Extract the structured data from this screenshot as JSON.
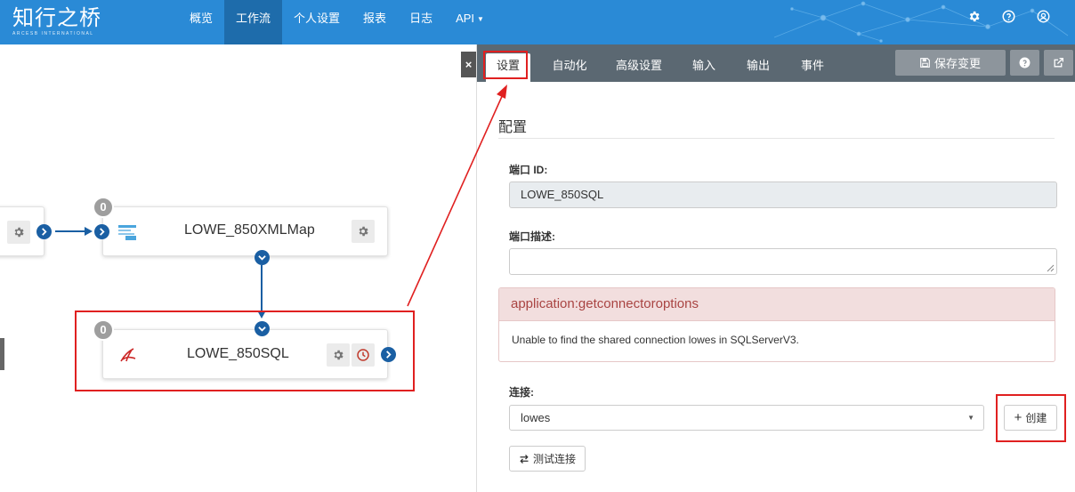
{
  "app": {
    "logo_text": "知行之桥",
    "logo_subtext": "ARCESB INTERNATIONAL"
  },
  "nav": {
    "items": [
      {
        "label": "概览"
      },
      {
        "label": "工作流"
      },
      {
        "label": "个人设置"
      },
      {
        "label": "报表"
      },
      {
        "label": "日志"
      },
      {
        "label": "API"
      }
    ],
    "active": "工作流",
    "top_icons": [
      "gear-icon",
      "help-icon",
      "user-icon"
    ]
  },
  "canvas": {
    "nodes": [
      {
        "title": "",
        "icon": "gear-icon"
      },
      {
        "title": "LOWE_850XMLMap",
        "badge": "0",
        "icon": "xml-map-icon"
      },
      {
        "title": "LOWE_850SQL",
        "badge": "0",
        "icon": "sqlserver-icon"
      }
    ],
    "close_label": "×"
  },
  "panel": {
    "tabs": [
      {
        "label": "设置"
      },
      {
        "label": "自动化"
      },
      {
        "label": "高级设置"
      },
      {
        "label": "输入"
      },
      {
        "label": "输出"
      },
      {
        "label": "事件"
      }
    ],
    "active_tab": "设置",
    "save_label": "保存变更",
    "section_title": "配置",
    "port_id_label": "端口 ID:",
    "port_id_value": "LOWE_850SQL",
    "port_desc_label": "端口描述:",
    "port_desc_value": "",
    "alert_title": "application:getconnectoroptions",
    "alert_message": "Unable to find the shared connection lowes in SQLServerV3.",
    "connection_label": "连接:",
    "connection_value": "lowes",
    "create_label": "创建",
    "test_label": "测试连接"
  },
  "colors": {
    "topbar": "#2a8ad6",
    "nav_active": "#1e6cab",
    "tabbar": "#5b6872",
    "port": "#1a5fa3",
    "highlight": "#e02020",
    "alert_bg": "#f2dede",
    "alert_text": "#a94442"
  }
}
